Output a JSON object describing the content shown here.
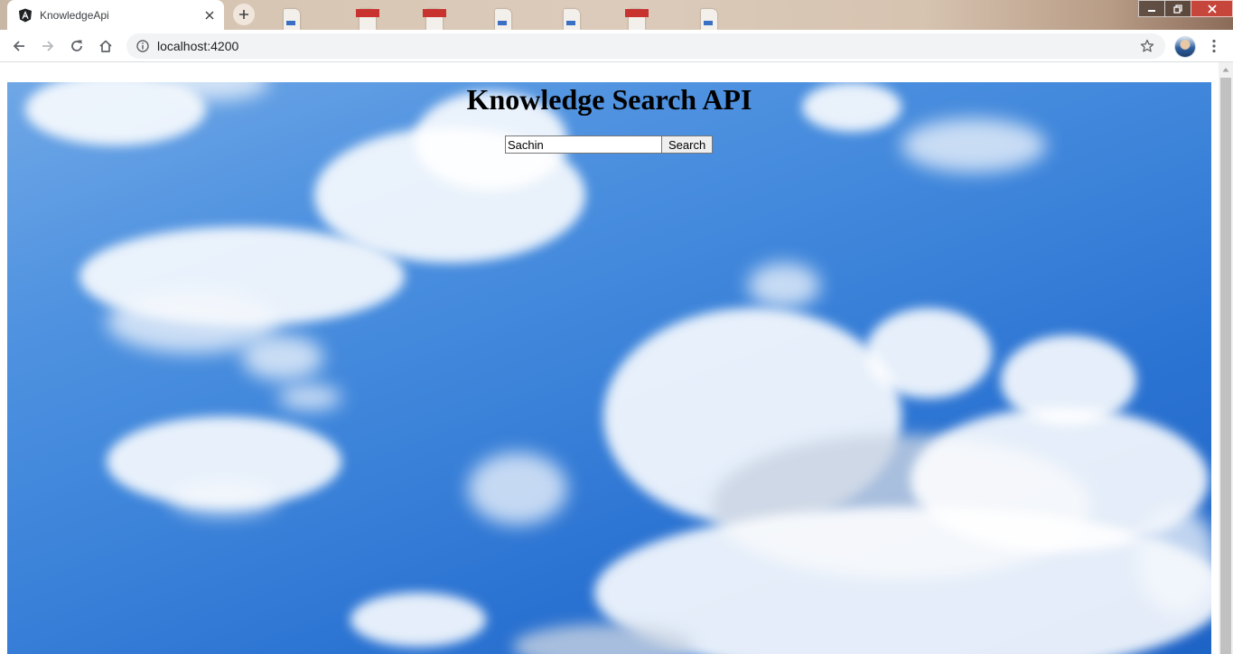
{
  "browser": {
    "tab": {
      "title": "KnowledgeApi",
      "favicon": "angular-icon"
    },
    "address_bar": {
      "url": "localhost:4200"
    },
    "icons": [
      "back-arrow-icon",
      "forward-arrow-icon",
      "reload-icon",
      "home-icon",
      "info-icon",
      "star-icon",
      "menu-icon"
    ]
  },
  "page": {
    "title": "Knowledge Search API",
    "search": {
      "value": "Sachin",
      "button_label": "Search"
    }
  },
  "colors": {
    "sky_top": "#6fa7e6",
    "sky_bottom": "#1e63c6",
    "tab_strip": "#d8c6b4"
  }
}
